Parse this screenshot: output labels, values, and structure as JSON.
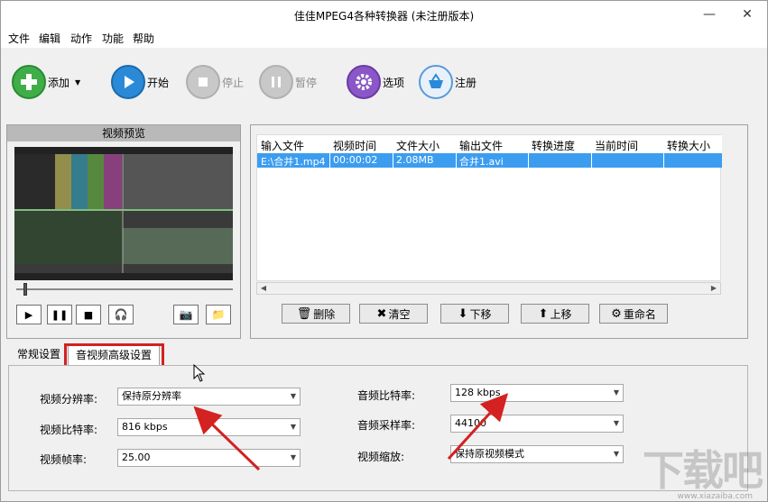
{
  "window": {
    "title": "佳佳MPEG4各种转换器  (未注册版本)",
    "minimize": "—",
    "close": "✕"
  },
  "menu": [
    "文件",
    "编辑",
    "动作",
    "功能",
    "帮助"
  ],
  "toolbar": {
    "add": "添加",
    "start": "开始",
    "stop": "停止",
    "pause": "暂停",
    "options": "选项",
    "register": "注册"
  },
  "preview": {
    "title": "视频预览"
  },
  "filelist": {
    "columns": [
      "输入文件",
      "视频时间",
      "文件大小",
      "输出文件",
      "转换进度",
      "当前时间",
      "转换大小"
    ],
    "rows": [
      [
        "E:\\合并1.mp4",
        "00:00:02",
        "2.08MB",
        "合并1.avi",
        "",
        "",
        ""
      ]
    ]
  },
  "actions": {
    "delete": "删除",
    "clear": "清空",
    "down": "下移",
    "up": "上移",
    "rename": "重命名"
  },
  "tabs": {
    "general": "常规设置",
    "advanced": "音视频高级设置"
  },
  "settings": {
    "video_resolution_label": "视频分辨率:",
    "video_resolution": "保持原分辨率",
    "video_bitrate_label": "视频比特率:",
    "video_bitrate": "816 kbps",
    "video_fps_label": "视频帧率:",
    "video_fps": "25.00",
    "audio_bitrate_label": "音频比特率:",
    "audio_bitrate": "128 kbps",
    "audio_samplerate_label": "音频采样率:",
    "audio_samplerate": "44100",
    "video_scale_label": "视频缩放:",
    "video_scale": "保持原视频模式"
  },
  "colors": {
    "selection": "#3c9df0",
    "highlight": "#d42121",
    "green": "#3fae49",
    "blue": "#2a8ad8",
    "purple": "#8a56c8"
  },
  "watermark": {
    "text": "下载吧",
    "site": "www.xiazaiba.com"
  }
}
